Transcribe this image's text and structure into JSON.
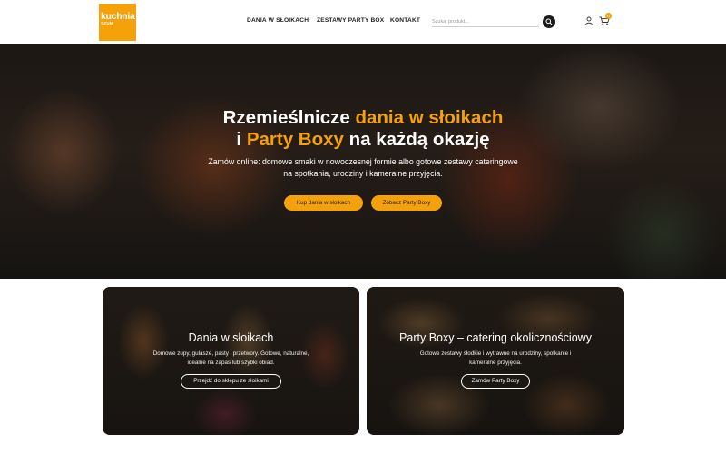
{
  "logo": {
    "main": "kuchnia",
    "sub": "SZUM"
  },
  "nav": [
    {
      "label": "DANIA W SŁOIKACH"
    },
    {
      "label": "ZESTAWY PARTY BOX"
    },
    {
      "label": "KONTAKT"
    }
  ],
  "search": {
    "placeholder": "Szukaj produkt..."
  },
  "cart": {
    "count": "0"
  },
  "hero": {
    "title_line1_start": "Rzemieślnicze ",
    "title_line1_highlight": "dania w słoikach",
    "title_line2_start": "i ",
    "title_line2_highlight": "Party Boxy",
    "title_line2_end": " na każdą okazję",
    "subtitle_line1": "Zamów online: domowe smaki w nowoczesnej formie albo gotowe zestawy cateringowe",
    "subtitle_line2": "na spotkania, urodziny i kameralne przyjęcia.",
    "button_primary": "Kup dania w słoikach",
    "button_secondary": "Zobacz Party Boxy"
  },
  "cards": [
    {
      "title": "Dania w słoikach",
      "text_line1": "Domowe zupy, gulasze, pasty i przetwory. Gotowe, naturalne,",
      "text_line2": "idealne na zapas lub szybki obiad.",
      "button": "Przejdź do sklepu ze słoikami"
    },
    {
      "title": "Party Boxy – catering okolicznościowy",
      "text_line1": "Gotowe zestawy słodkie i wytrawne na urodziny, spotkanie i",
      "text_line2": "kameralne przyjęcia.",
      "button": "Zamów Party Boxy"
    }
  ],
  "colors": {
    "accent": "#f5a20a",
    "dark": "#1c1c1c"
  }
}
